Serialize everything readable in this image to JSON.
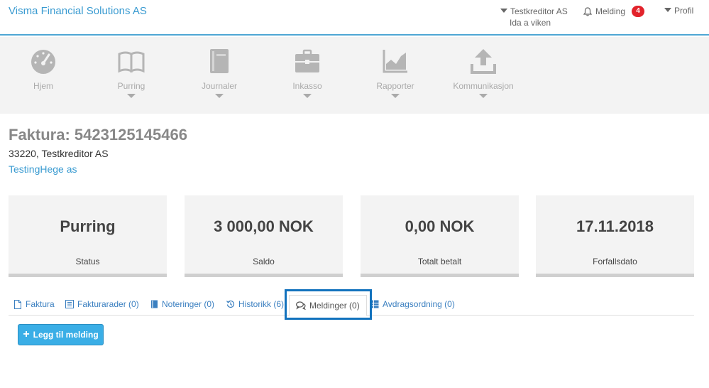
{
  "topbar": {
    "brand": "Visma Financial Solutions AS",
    "creditor_name": "Testkreditor AS",
    "creditor_user": "Ida a viken",
    "melding_label": "Melding",
    "melding_count": "4",
    "profile_label": "Profil"
  },
  "nav": {
    "items": [
      {
        "label": "Hjem",
        "icon": "dashboard-gauge-icon"
      },
      {
        "label": "Purring",
        "icon": "book-icon"
      },
      {
        "label": "Journaler",
        "icon": "notebook-icon"
      },
      {
        "label": "Inkasso",
        "icon": "briefcase-icon"
      },
      {
        "label": "Rapporter",
        "icon": "chart-icon"
      },
      {
        "label": "Kommunikasjon",
        "icon": "upload-icon"
      }
    ]
  },
  "invoice": {
    "title": "Faktura: 5423125145466",
    "subtitle": "33220, Testkreditor AS",
    "debtor_link": "TestingHege as"
  },
  "cards": [
    {
      "value": "Purring",
      "label": "Status"
    },
    {
      "value": "3 000,00 NOK",
      "label": "Saldo"
    },
    {
      "value": "0,00 NOK",
      "label": "Totalt betalt"
    },
    {
      "value": "17.11.2018",
      "label": "Forfallsdato"
    }
  ],
  "tabs": {
    "items": [
      {
        "label": "Faktura",
        "icon": "document-icon"
      },
      {
        "label": "Fakturarader (0)",
        "icon": "list-icon"
      },
      {
        "label": "Noteringer (0)",
        "icon": "notebook-icon"
      },
      {
        "label": "Historikk (6)",
        "icon": "history-icon"
      },
      {
        "label": "Meldinger (0)",
        "icon": "chat-icon"
      },
      {
        "label": "Avdragsordning (0)",
        "icon": "table-icon"
      }
    ],
    "active": "Meldinger (0)"
  },
  "actions": {
    "add_message": "Legg til melding"
  },
  "colors": {
    "accent": "#3a9bd1",
    "highlight": "#1272bd",
    "badge": "#e2232b",
    "button": "#3aaee6"
  }
}
